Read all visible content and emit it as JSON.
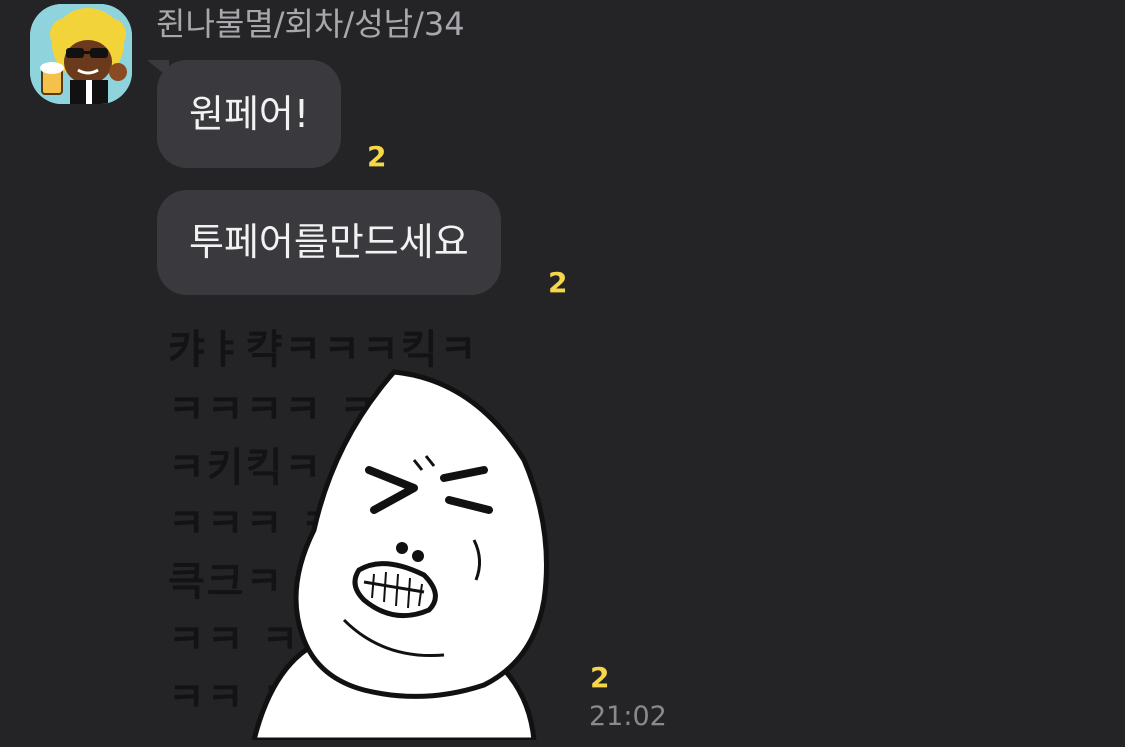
{
  "sender": {
    "name": "쥔나불멸/회차/성남/34",
    "avatar_icon": "character-avatar-icon"
  },
  "messages": [
    {
      "text": "원페어!",
      "unread": "2"
    },
    {
      "text": "투페어를만드세요",
      "unread": "2"
    }
  ],
  "sticker": {
    "icon": "laughing-face-sticker-icon",
    "background_rows": [
      "캬ㅑ캭ㅋㅋㅋ킥ㅋ",
      "ㅋㅋㅋㅋ      ㅋ",
      "ㅋ키킥ㅋ",
      "ㅋㅋㅋ         ㅋ",
      "큭크ㅋ         ㅋ",
      "ㅋㅋ           ㅋ",
      "ㅋㅋ           ㅋ"
    ],
    "unread": "2",
    "time": "21:02"
  },
  "colors": {
    "background": "#242427",
    "bubble": "#3a3a3e",
    "unread": "#f6d64b",
    "avatar_bg": "#8fd3dc"
  }
}
